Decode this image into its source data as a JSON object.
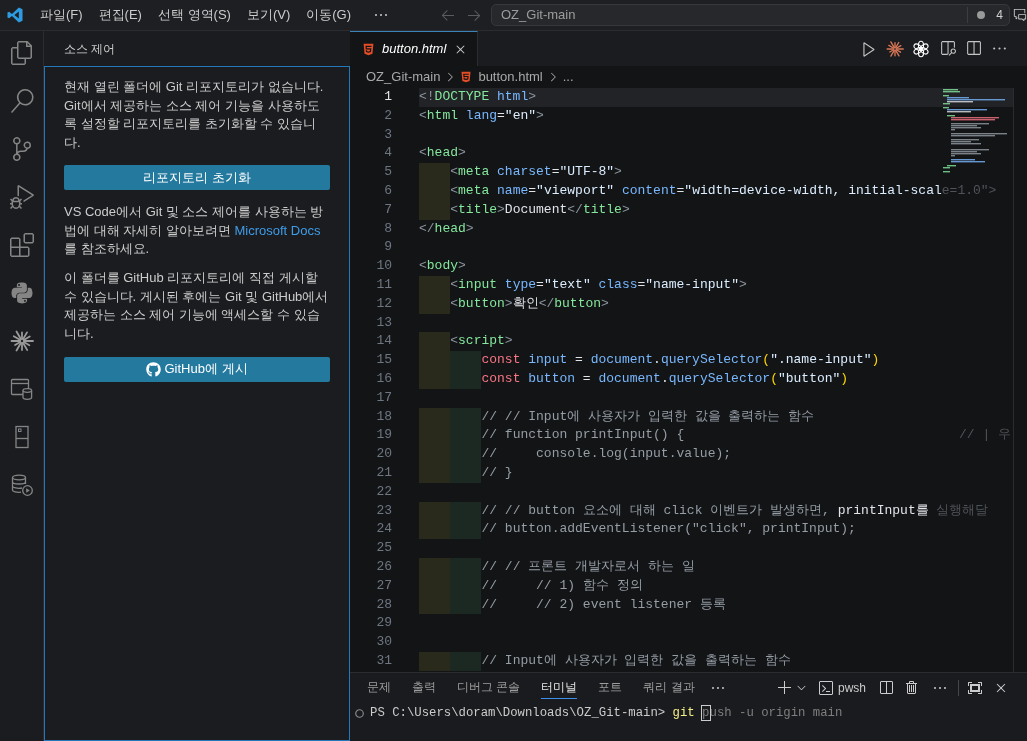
{
  "title_bar": {
    "menus": [
      "파일(F)",
      "편집(E)",
      "선택 영역(S)",
      "보기(V)",
      "이동(G)"
    ],
    "nav": [
      {
        "kind": "back",
        "disabled": true
      },
      {
        "kind": "forward",
        "disabled": true
      }
    ],
    "command_center": {
      "text": "OZ_Git-main",
      "count": "4"
    }
  },
  "activity_bar": {
    "items": [
      {
        "kind": "explorer"
      },
      {
        "kind": "search"
      },
      {
        "kind": "source_control"
      },
      {
        "kind": "run_debug"
      },
      {
        "kind": "extensions"
      },
      {
        "kind": "python"
      },
      {
        "kind": "burst"
      },
      {
        "kind": "window_database"
      },
      {
        "kind": "cabinet"
      },
      {
        "kind": "database_play"
      }
    ]
  },
  "sidebar": {
    "title": "소스 제어",
    "intro": "현재 열린 폴더에 Git 리포지토리가 없습니다. Git에서 제공하는 소스 제어 기능을 사용하도록 설정할 리포지토리를 초기화할 수 있습니다.",
    "init_button": "리포지토리 초기화",
    "docs_text": {
      "before": "VS Code에서 Git 및 소스 제어를 사용하는 방법에 대해 자세히 알아보려면 ",
      "link": "Microsoft Docs",
      "after": "를 참조하세요."
    },
    "publish_text": "이 폴더를 GitHub 리포지토리에 직접 게시할 수 있습니다. 게시된 후에는 Git 및 GitHub에서 제공하는 소스 제어 기능에 액세스할 수 있습니다.",
    "publish_button": "GitHub에 게시"
  },
  "editor": {
    "tabs": [
      {
        "label": "button.html",
        "selected": true,
        "preview": true
      }
    ],
    "actions": [
      {
        "kind": "run"
      },
      {
        "kind": "claude"
      },
      {
        "kind": "openai"
      },
      {
        "kind": "preview"
      },
      {
        "kind": "split"
      },
      {
        "kind": "more"
      }
    ],
    "breadcrumbs": [
      {
        "kind": "folder",
        "label": "OZ_Git-main"
      },
      {
        "kind": "html",
        "label": "button.html"
      },
      {
        "kind": "symbol",
        "label": "..."
      }
    ],
    "lines": [
      {
        "number": "1",
        "current": true,
        "tokens": [
          {
            "kind": "punct",
            "text": "<!"
          },
          {
            "kind": "tag",
            "text": "DOCTYPE"
          },
          {
            "kind": "attr",
            "text": " html"
          },
          {
            "kind": "punct",
            "text": ">"
          }
        ]
      },
      {
        "number": "2",
        "current": false,
        "tokens": [
          {
            "kind": "punct",
            "text": "<"
          },
          {
            "kind": "tag",
            "text": "html"
          },
          {
            "kind": "attr",
            "text": " lang"
          },
          {
            "kind": "text",
            "text": "="
          },
          {
            "kind": "string",
            "text": "\"en\""
          },
          {
            "kind": "punct",
            "text": ">"
          }
        ]
      },
      {
        "number": "3",
        "current": false
      },
      {
        "number": "4",
        "current": false,
        "tokens": [
          {
            "kind": "punct",
            "text": "<"
          },
          {
            "kind": "tag",
            "text": "head"
          },
          {
            "kind": "punct",
            "text": ">"
          }
        ]
      },
      {
        "number": "5",
        "current": false,
        "tokens": [
          {
            "kind": "punct",
            "text": "    <"
          },
          {
            "kind": "tag",
            "text": "meta"
          },
          {
            "kind": "attr",
            "text": " charset"
          },
          {
            "kind": "text",
            "text": "="
          },
          {
            "kind": "string",
            "text": "\"UTF-8\""
          },
          {
            "kind": "punct",
            "text": ">"
          }
        ]
      },
      {
        "number": "6",
        "current": false,
        "tokens": [
          {
            "kind": "punct",
            "text": "    <"
          },
          {
            "kind": "tag",
            "text": "meta"
          },
          {
            "kind": "attr",
            "text": " name"
          },
          {
            "kind": "text",
            "text": "="
          },
          {
            "kind": "string",
            "text": "\"viewport\""
          },
          {
            "kind": "attr",
            "text": " content"
          },
          {
            "kind": "text",
            "text": "="
          },
          {
            "kind": "string",
            "text": "\"width=device-width, initial-scal"
          },
          {
            "kind": "dim",
            "text": "e=1.0\">"
          }
        ]
      },
      {
        "number": "7",
        "current": false,
        "tokens": [
          {
            "kind": "punct",
            "text": "    <"
          },
          {
            "kind": "tag",
            "text": "title"
          },
          {
            "kind": "punct",
            "text": ">"
          },
          {
            "kind": "text",
            "text": "Document"
          },
          {
            "kind": "punct",
            "text": "</"
          },
          {
            "kind": "tag",
            "text": "title"
          },
          {
            "kind": "punct",
            "text": ">"
          }
        ]
      },
      {
        "number": "8",
        "current": false,
        "tokens": [
          {
            "kind": "punct",
            "text": "</"
          },
          {
            "kind": "tag",
            "text": "head"
          },
          {
            "kind": "punct",
            "text": ">"
          }
        ]
      },
      {
        "number": "9",
        "current": false
      },
      {
        "number": "10",
        "current": false,
        "tokens": [
          {
            "kind": "punct",
            "text": "<"
          },
          {
            "kind": "tag",
            "text": "body"
          },
          {
            "kind": "punct",
            "text": ">"
          }
        ]
      },
      {
        "number": "11",
        "current": false,
        "tokens": [
          {
            "kind": "punct",
            "text": "    <"
          },
          {
            "kind": "tag",
            "text": "input"
          },
          {
            "kind": "attr",
            "text": " type"
          },
          {
            "kind": "text",
            "text": "="
          },
          {
            "kind": "string",
            "text": "\"text\""
          },
          {
            "kind": "attr",
            "text": " class"
          },
          {
            "kind": "text",
            "text": "="
          },
          {
            "kind": "string",
            "text": "\"name-input\""
          },
          {
            "kind": "punct",
            "text": ">"
          }
        ]
      },
      {
        "number": "12",
        "current": false,
        "tokens": [
          {
            "kind": "punct",
            "text": "    <"
          },
          {
            "kind": "tag",
            "text": "button"
          },
          {
            "kind": "punct",
            "text": ">"
          },
          {
            "kind": "text",
            "text": "확인"
          },
          {
            "kind": "punct",
            "text": "</"
          },
          {
            "kind": "tag",
            "text": "button"
          },
          {
            "kind": "punct",
            "text": ">"
          }
        ]
      },
      {
        "number": "13",
        "current": false
      },
      {
        "number": "14",
        "current": false,
        "tokens": [
          {
            "kind": "punct",
            "text": "    <"
          },
          {
            "kind": "tag",
            "text": "script"
          },
          {
            "kind": "punct",
            "text": ">"
          }
        ]
      },
      {
        "number": "15",
        "current": false,
        "tokens": [
          {
            "kind": "keyword",
            "text": "        const"
          },
          {
            "kind": "variable",
            "text": " input"
          },
          {
            "kind": "text",
            "text": " = "
          },
          {
            "kind": "variable",
            "text": "document"
          },
          {
            "kind": "text",
            "text": "."
          },
          {
            "kind": "function",
            "text": "querySelector"
          },
          {
            "kind": "bracket",
            "text": "("
          },
          {
            "kind": "string",
            "text": "\".name-input\""
          },
          {
            "kind": "bracket",
            "text": ")"
          }
        ]
      },
      {
        "number": "16",
        "current": false,
        "tokens": [
          {
            "kind": "keyword",
            "text": "        const"
          },
          {
            "kind": "variable",
            "text": " button"
          },
          {
            "kind": "text",
            "text": " = "
          },
          {
            "kind": "variable",
            "text": "document"
          },
          {
            "kind": "text",
            "text": "."
          },
          {
            "kind": "function",
            "text": "querySelector"
          },
          {
            "kind": "bracket",
            "text": "("
          },
          {
            "kind": "string",
            "text": "\"button\""
          },
          {
            "kind": "bracket",
            "text": ")"
          }
        ]
      },
      {
        "number": "17",
        "current": false
      },
      {
        "number": "18",
        "current": false,
        "tokens": [
          {
            "kind": "comment",
            "text": "        // // Input에 사용자가 입력한 값을 출력하는 함수"
          }
        ]
      },
      {
        "number": "19",
        "current": false,
        "tokens": [
          {
            "kind": "comment",
            "text": "        // function printInput() {"
          },
          {
            "kind": "far",
            "text": "// | 우"
          }
        ]
      },
      {
        "number": "20",
        "current": false,
        "tokens": [
          {
            "kind": "comment",
            "text": "        //     console.log(input.value);"
          }
        ]
      },
      {
        "number": "21",
        "current": false,
        "tokens": [
          {
            "kind": "comment",
            "text": "        // }"
          }
        ]
      },
      {
        "number": "22",
        "current": false
      },
      {
        "number": "23",
        "current": false,
        "tokens": [
          {
            "kind": "comment",
            "text": "        // // button 요소에 대해 click 이벤트가 발생하면, "
          },
          {
            "kind": "highlight",
            "text": "printInput를"
          },
          {
            "kind": "dim",
            "text": " 실행해달"
          }
        ]
      },
      {
        "number": "24",
        "current": false,
        "tokens": [
          {
            "kind": "comment",
            "text": "        // button.addEventListener(\"click\", printInput);"
          }
        ]
      },
      {
        "number": "25",
        "current": false
      },
      {
        "number": "26",
        "current": false,
        "tokens": [
          {
            "kind": "comment",
            "text": "        // // 프론트 개발자로서 하는 일"
          }
        ]
      },
      {
        "number": "27",
        "current": false,
        "tokens": [
          {
            "kind": "comment",
            "text": "        //     // 1) 함수 정의"
          }
        ]
      },
      {
        "number": "28",
        "current": false,
        "tokens": [
          {
            "kind": "comment",
            "text": "        //     // 2) event listener 등록"
          }
        ]
      },
      {
        "number": "29",
        "current": false
      },
      {
        "number": "30",
        "current": false
      },
      {
        "number": "31",
        "current": false,
        "tokens": [
          {
            "kind": "comment",
            "text": "        // Input에 사용자가 입력한 값을 출력하는 함수"
          }
        ]
      }
    ]
  },
  "panel": {
    "tabs": [
      {
        "label": "문제",
        "selected": false
      },
      {
        "label": "출력",
        "selected": false
      },
      {
        "label": "디버그 콘솔",
        "selected": false
      },
      {
        "label": "터미널",
        "selected": true
      },
      {
        "label": "포트",
        "selected": false
      },
      {
        "label": "쿼리 결과",
        "selected": false
      }
    ],
    "shell": "pwsh",
    "terminal": {
      "prompt": "PS C:\\Users\\doram\\Downloads\\OZ_Git-main>",
      "command": "git",
      "suggestion": "push -u origin main",
      "cursor": true
    }
  }
}
